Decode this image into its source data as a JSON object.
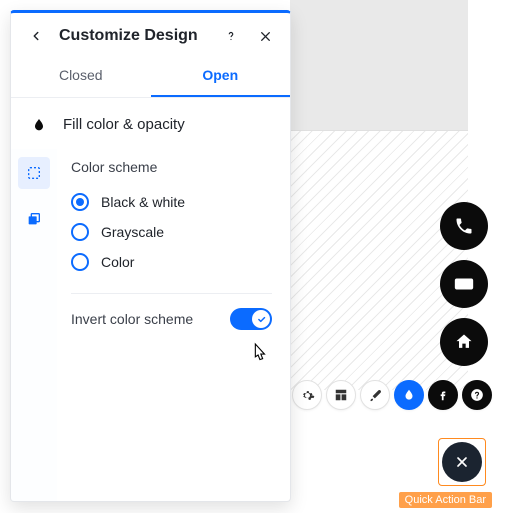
{
  "panel": {
    "title": "Customize Design",
    "tabs": {
      "closed": "Closed",
      "open": "Open",
      "active": "open"
    },
    "section_title": "Fill color & opacity",
    "color_scheme": {
      "label": "Color scheme",
      "options": [
        "Black & white",
        "Grayscale",
        "Color"
      ],
      "selected": 0
    },
    "invert": {
      "label": "Invert color scheme",
      "value": true
    }
  },
  "fabs": [
    "phone-icon",
    "mail-icon",
    "home-icon"
  ],
  "toolbar_icons": [
    "gear-icon",
    "layout-icon",
    "brush-icon",
    "droplet-icon",
    "facebook-icon",
    "help-icon"
  ],
  "tag": "Quick Action Bar",
  "colors": {
    "accent": "#0b6bff",
    "dark": "#0b0b0b",
    "orange": "#ff8a1f"
  }
}
